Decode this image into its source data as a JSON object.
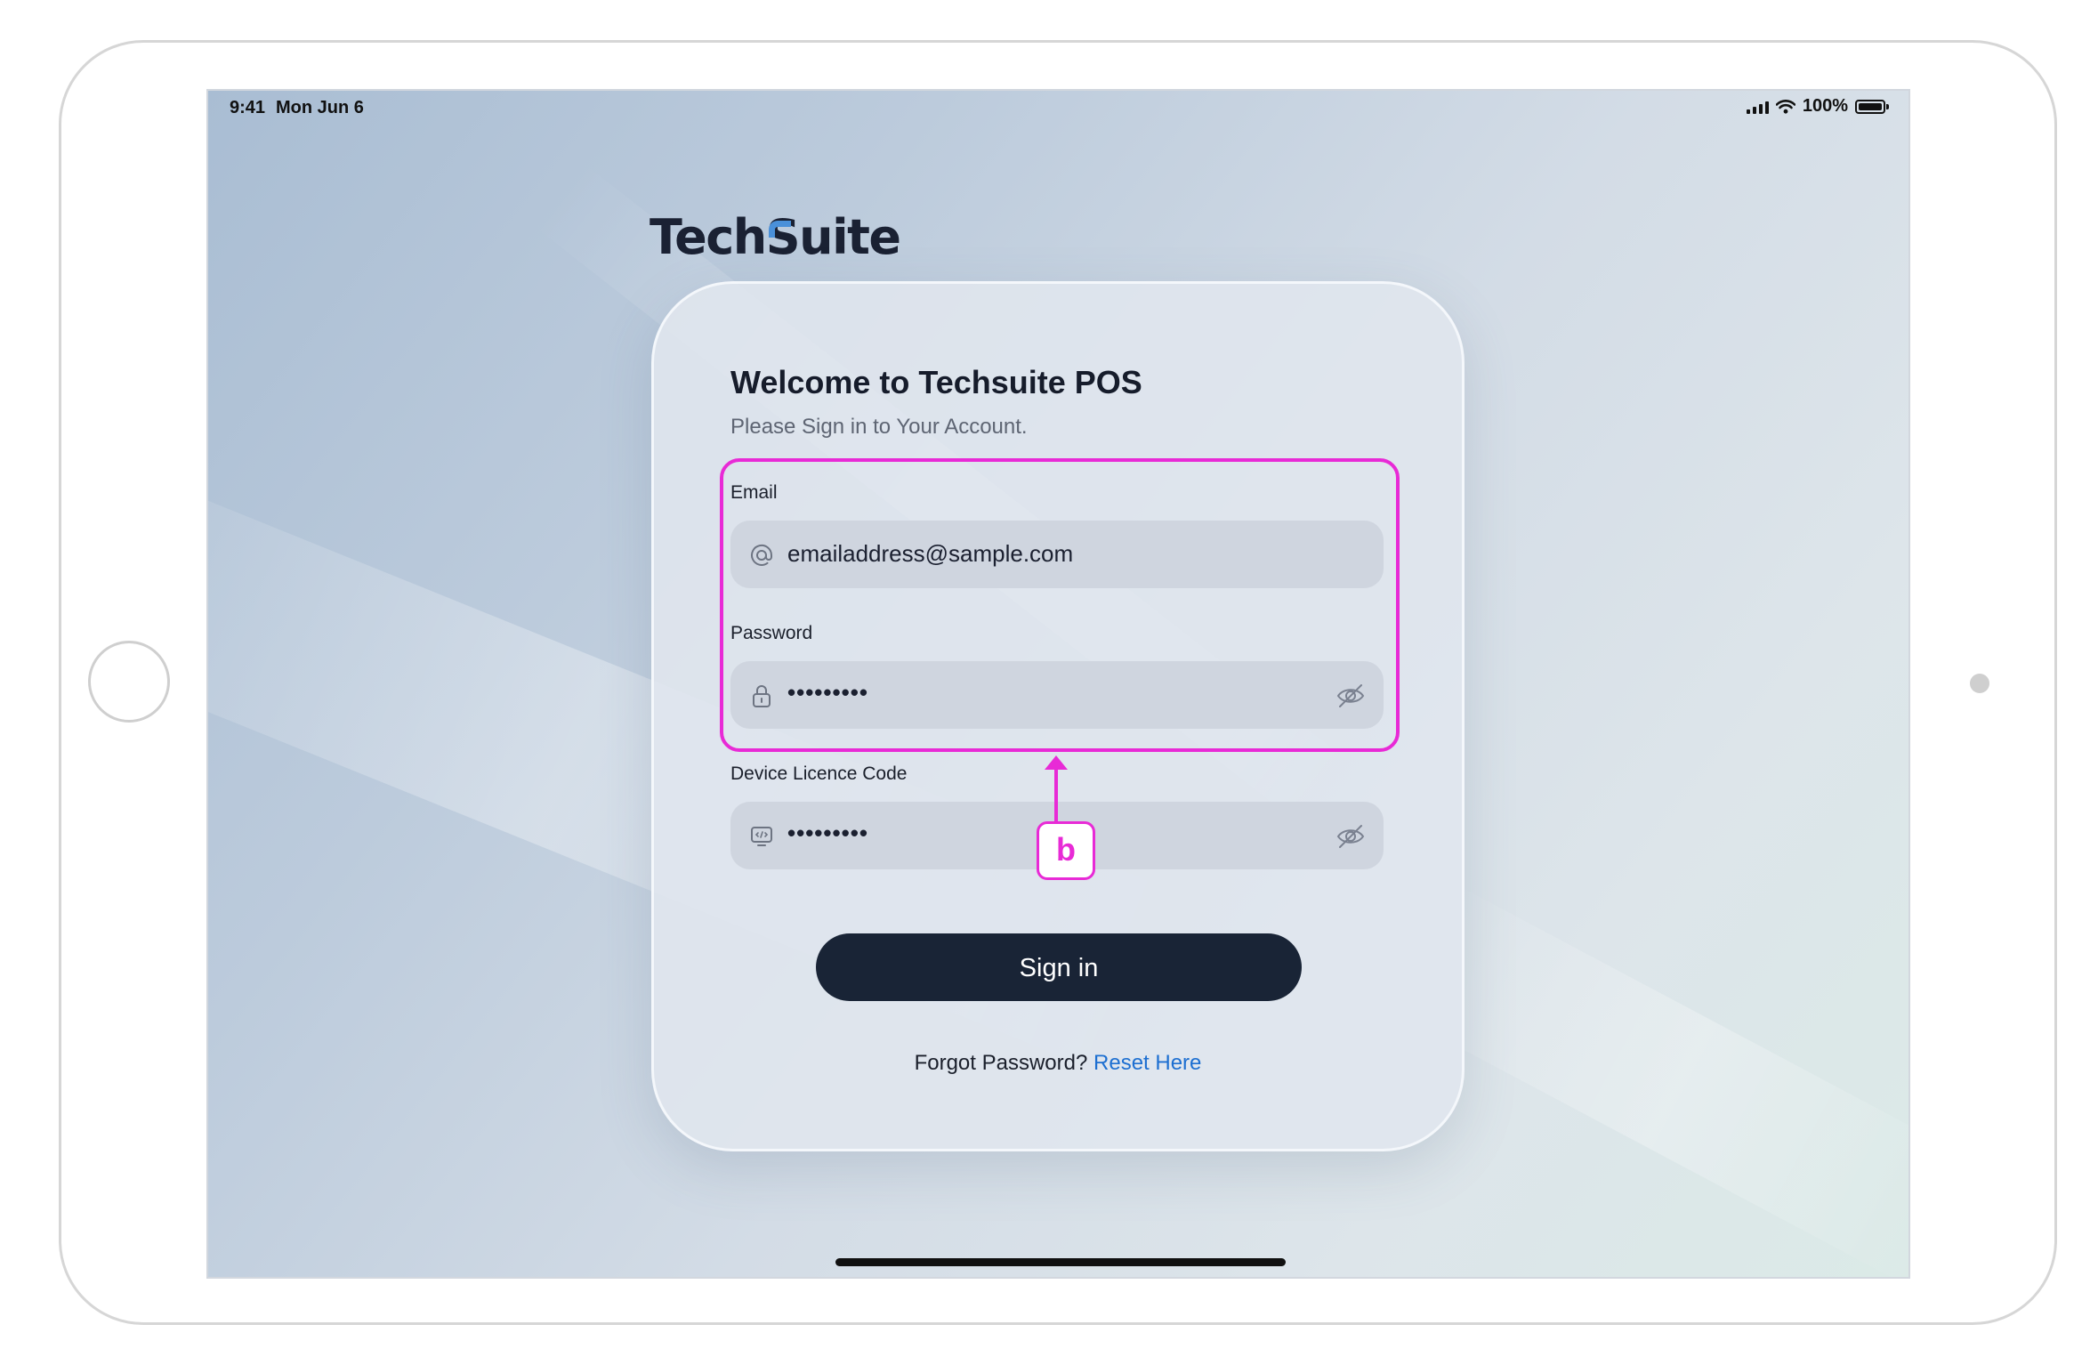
{
  "status_bar": {
    "time": "9:41",
    "date": "Mon Jun 6",
    "battery": "100%"
  },
  "logo": {
    "text_part1": "Tech",
    "text_s": "S",
    "text_part2": "uite",
    "accent_color": "#4a90d9"
  },
  "login": {
    "title": "Welcome to Techsuite POS",
    "subtitle": "Please Sign in to Your Account.",
    "email": {
      "label": "Email",
      "value": "emailaddress@sample.com",
      "icon": "at-icon"
    },
    "password": {
      "label": "Password",
      "value": "•••••••••",
      "icon": "lock-icon",
      "toggle_icon": "eye-off-icon"
    },
    "licence": {
      "label": "Device Licence Code",
      "value": "•••••••••",
      "icon": "code-monitor-icon",
      "toggle_icon": "eye-off-icon"
    },
    "sign_in_label": "Sign in",
    "forgot_text": "Forgot Password?",
    "reset_link": "Reset Here"
  },
  "annotation": {
    "badge_label": "b",
    "color": "#e82ad6"
  },
  "colors": {
    "button_bg": "#192436",
    "link": "#1d6fd1"
  }
}
